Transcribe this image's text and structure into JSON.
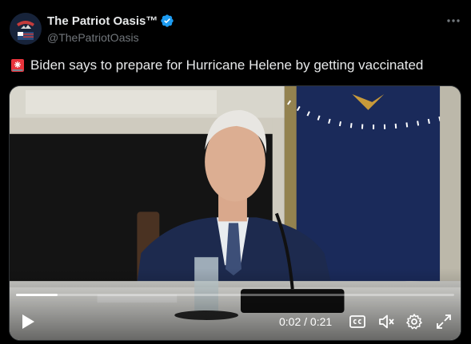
{
  "post": {
    "display_name": "The Patriot Oasis™",
    "handle": "@ThePatriotOasis",
    "text": "Biden says to prepare for Hurricane Helene by getting vaccinated",
    "avatar_text": "PATRIOT"
  },
  "video": {
    "current_time": "0:02",
    "duration": "0:21",
    "time_display": "0:02 / 0:21",
    "progress_fraction": 0.095
  },
  "icons": {
    "verified": "verified-badge-icon",
    "more": "more-options-icon",
    "siren": "siren-emoji-icon",
    "play": "play-icon",
    "captions": "captions-icon",
    "mute": "mute-icon",
    "settings": "settings-icon",
    "fullscreen": "fullscreen-icon"
  },
  "colors": {
    "background": "#000000",
    "text": "#e7e9ea",
    "secondary": "#71767b",
    "verified": "#1d9bf0"
  }
}
